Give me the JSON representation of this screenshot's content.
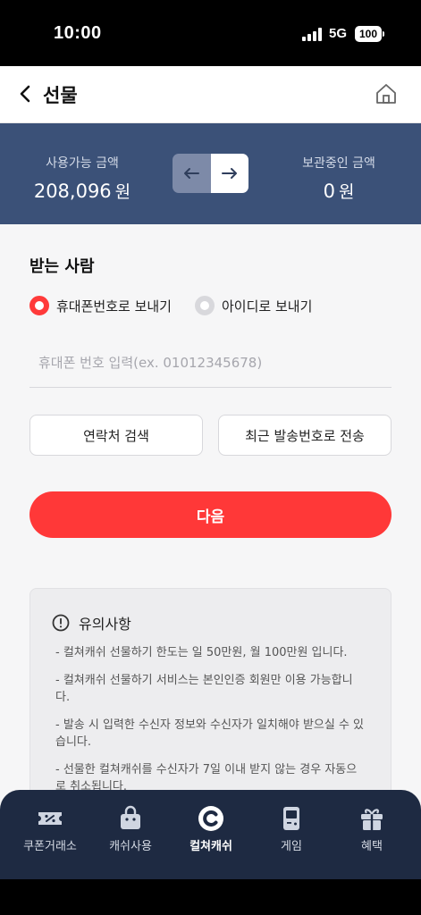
{
  "status_bar": {
    "time": "10:00",
    "network": "5G",
    "battery": "100"
  },
  "header": {
    "title": "선물"
  },
  "balance": {
    "available_label": "사용가능 금액",
    "available_amount": "208,096",
    "available_unit": "원",
    "stored_label": "보관중인 금액",
    "stored_amount": "0",
    "stored_unit": "원"
  },
  "recipient": {
    "section_title": "받는 사람",
    "options": [
      "휴대폰번호로 보내기",
      "아이디로 보내기"
    ],
    "selected_option": "휴대폰번호로 보내기",
    "phone_placeholder": "휴대폰 번호 입력(ex. 01012345678)",
    "contacts_button": "연락처 검색",
    "recent_button": "최근 발송번호로 전송",
    "next_button": "다음"
  },
  "notice": {
    "title": "유의사항",
    "items": [
      "- 컬쳐캐쉬 선물하기 한도는 일 50만원, 월 100만원 입니다.",
      "- 컬쳐캐쉬 선물하기 서비스는 본인인증 회원만 이용 가능합니다.",
      "- 발송 시 입력한 수신자 정보와 수신자가 일치해야 받으실 수 있습니다.",
      "- 선물한 컬쳐캐쉬를 수신자가 7일 이내 받지 않는 경우 자동으로 취소됩니다."
    ]
  },
  "tabbar": {
    "items": [
      {
        "label": "쿠폰거래소",
        "icon": "coupon-icon"
      },
      {
        "label": "캐쉬사용",
        "icon": "shopping-bag-icon"
      },
      {
        "label": "컬쳐캐쉬",
        "icon": "culture-cash-logo-icon"
      },
      {
        "label": "게임",
        "icon": "gameboy-icon"
      },
      {
        "label": "혜택",
        "icon": "gift-icon"
      }
    ],
    "active": "컬쳐캐쉬"
  },
  "colors": {
    "accent": "#ff3838",
    "panel": "#3b5178",
    "tabbar": "#1e2a42"
  }
}
